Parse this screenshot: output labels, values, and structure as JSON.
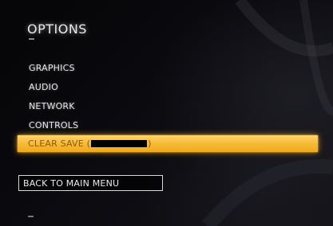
{
  "screen": {
    "title": "OPTIONS"
  },
  "menu": {
    "items": [
      {
        "label": "GRAPHICS"
      },
      {
        "label": "AUDIO"
      },
      {
        "label": "NETWORK"
      },
      {
        "label": "CONTROLS"
      }
    ],
    "selected": {
      "prefix": "CLEAR SAVE (",
      "suffix": ")"
    }
  },
  "back_button": {
    "label": "BACK TO MAIN MENU"
  },
  "colors": {
    "highlight": "#f6b833",
    "highlight_text": "#8a5a10",
    "text": "#e6e6e6",
    "background": "#000000"
  }
}
